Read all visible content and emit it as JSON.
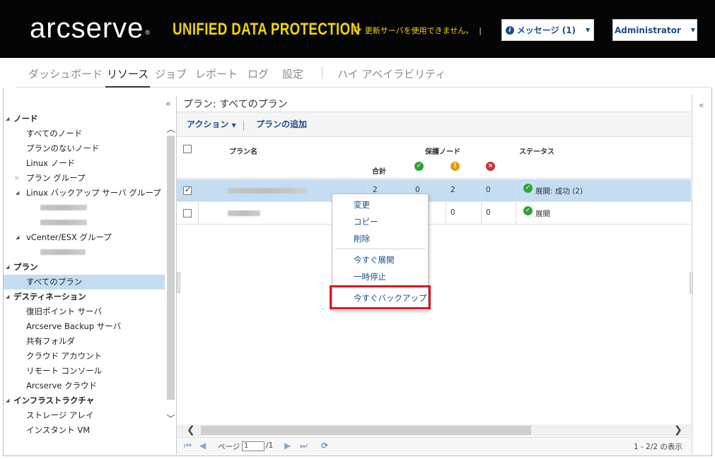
{
  "header": {
    "logo": "arcserve",
    "logo_mark": "®",
    "product": "UNIFIED DATA PROTECTION",
    "update_message": "更新サーバを使用できません。",
    "messages_button": "メッセージ (1)",
    "user_button": "Administrator"
  },
  "nav": {
    "tabs": [
      {
        "label": "ダッシュボード"
      },
      {
        "label": "リソース"
      },
      {
        "label": "ジョブ"
      },
      {
        "label": "レポート"
      },
      {
        "label": "ログ"
      },
      {
        "label": "設定"
      },
      {
        "label": "ハイ アベイラビリティ"
      }
    ],
    "active_tab": "リソース"
  },
  "sidebar": {
    "groups": {
      "nodes": "ノード",
      "plans": "プラン",
      "destinations": "デスティネーション",
      "infrastructure": "インフラストラクチャ"
    },
    "items": {
      "all_nodes": "すべてのノード",
      "nodes_without_plan": "プランのないノード",
      "linux_nodes": "Linux ノード",
      "plan_groups": "プラン グループ",
      "linux_backup_server_groups": "Linux バックアップ サーバ グループ",
      "vcenter_esx_groups": "vCenter/ESX グループ",
      "all_plans": "すべてのプラン",
      "recovery_point_servers": "復旧ポイント サーバ",
      "arcserve_backup_servers": "Arcserve Backup サーバ",
      "shared_folders": "共有フォルダ",
      "cloud_accounts": "クラウド アカウント",
      "remote_consoles": "リモート コンソール",
      "arcserve_cloud": "Arcserve クラウド",
      "storage_arrays": "ストレージ アレイ",
      "instant_vms": "インスタント VM"
    }
  },
  "main": {
    "title": "プラン: すべてのプラン",
    "toolbar": {
      "actions": "アクション",
      "add_plan": "プランの追加"
    },
    "columns": {
      "plan_name": "プラン名",
      "protected_nodes": "保護ノード",
      "status": "ステータス",
      "total": "合計"
    },
    "rows": [
      {
        "total": "2",
        "ok": "0",
        "warn": "2",
        "err": "0",
        "status": "展開: 成功 (2)",
        "selected": true
      },
      {
        "total": "",
        "ok": "",
        "warn": "0",
        "err": "0",
        "status": "展開",
        "selected": false
      }
    ],
    "pager": {
      "page_label": "ページ",
      "page_value": "1",
      "page_of": "/1",
      "range": "1 - 2/2 の表示"
    }
  },
  "context_menu": {
    "items": [
      "変更",
      "コピー",
      "削除",
      "今すぐ展開",
      "一時停止",
      "今すぐバックアップ"
    ],
    "highlighted": "今すぐバックアップ"
  },
  "colors": {
    "header_bg": "#050505",
    "product_yellow": "#f2d400",
    "link_blue": "#1a4d8a",
    "selection": "#c5ddf2",
    "highlight_red": "#e0141e"
  }
}
